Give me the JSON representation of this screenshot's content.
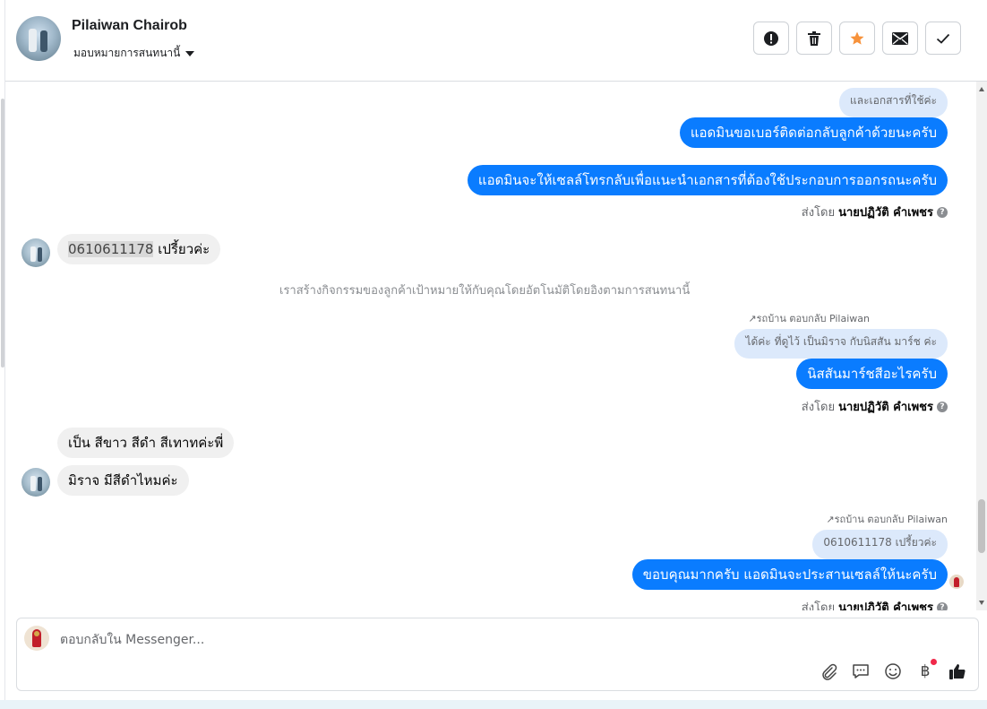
{
  "header": {
    "name": "Pilaiwan Chairob",
    "assign_label": "มอบหมายการสนทนานี้",
    "actions": [
      {
        "icon": "alert-icon",
        "label": "Mark as spam"
      },
      {
        "icon": "trash-icon",
        "label": "Delete"
      },
      {
        "icon": "star-icon",
        "label": "Star",
        "color": "#f7923b"
      },
      {
        "icon": "mail-icon",
        "label": "Mark as unread"
      },
      {
        "icon": "check-icon",
        "label": "Done"
      }
    ]
  },
  "messages": {
    "quote1": "และเอกสารที่ใช้ค่ะ",
    "out1": "แอดมินขอเบอร์ติดต่อกลับลูกค้าด้วยนะครับ",
    "out2": "แอดมินจะให้เซลล์โทรกลับเพื่อแนะนำเอกสารที่ต้องใช้ประกอบการออกรถนะครับ",
    "sent_by_prefix": "ส่งโดย",
    "sent_by_name": "นายปฏิวัติ คำเพชร",
    "in1_highlight": "0610611178",
    "in1_rest": " เปรี้ยวค่ะ",
    "system": "เราสร้างกิจกรรมของลูกค้าเป้าหมายให้กับคุณโดยอัตโนมัติโดยอิงตามการสนทนานี้",
    "reply_note": "รถบ้าน ตอบกลับ Pilaiwan",
    "quote2": "ได้ค่ะ ที่ดูไว้ เป็นมิราจ กับนิสสัน มาร์ช ค่ะ",
    "out3": "นิสสันมาร์ชสีอะไรครับ",
    "in2": "เป็น สีขาว สีดำ สีเทาทค่ะพี่",
    "in3": "มิราจ มีสีดำไหมค่ะ",
    "reply_note2": "รถบ้าน ตอบกลับ Pilaiwan",
    "quote3": "0610611178 เปรี้ยวค่ะ",
    "out4": "ขอบคุณมากครับ แอดมินจะประสานเซลล์ให้นะครับ"
  },
  "composer": {
    "placeholder": "ตอบกลับใน Messenger...",
    "tools": [
      "attachment-icon",
      "saved-reply-icon",
      "emoji-icon",
      "payment-icon",
      "like-icon"
    ],
    "payment_symbol": "฿"
  },
  "colors": {
    "outgoing": "#0a7cff",
    "incoming": "#f0f0f0",
    "quote": "#dce9fb",
    "notification_dot": "#f02849"
  }
}
